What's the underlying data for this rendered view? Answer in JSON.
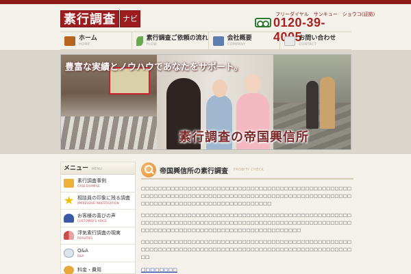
{
  "header": {
    "logo_text": "素行調査",
    "logo_sub": "ナビ",
    "phone_caption": "フリーダイヤル　サンキュー　ショウコ(証拠)",
    "phone_number": "0120-39-4005"
  },
  "nav": {
    "items": [
      {
        "label": "ホーム",
        "en": "HOME",
        "icon": "home-icon",
        "color": "#b5651d"
      },
      {
        "label": "素行調査ご依頼の流れ",
        "en": "FLOW",
        "icon": "leaf-icon",
        "color": "#6aa84f"
      },
      {
        "label": "会社概要",
        "en": "COMPANY",
        "icon": "book-icon",
        "color": "#5b7fb0"
      },
      {
        "label": "お問い合わせ",
        "en": "CONTACT",
        "icon": "mail-icon",
        "color": "#cfcfcf"
      }
    ]
  },
  "hero": {
    "tagline": "豊富な実績とノウハウであなたをサポート。",
    "title": "素行調査の帝国興信所"
  },
  "sidebar": {
    "title": "メニュー",
    "title_en": "MENU",
    "items": [
      {
        "label": "素行調査事例",
        "en": "CASE EXAMPLE",
        "icon": "folder-icon",
        "color": "#f0b13c"
      },
      {
        "label": "相談員の印象に残る調査",
        "en": "IMPRESSIVE INVESTIGATION",
        "icon": "star-icon",
        "color": "#f0c000"
      },
      {
        "label": "お客様の喜びの声",
        "en": "CUSTOMER'S VOICE",
        "icon": "person-icon",
        "color": "#3a5aa8"
      },
      {
        "label": "浮気素行調査の現実",
        "en": "REALITIES",
        "icon": "couple-icon",
        "color": "#d04a4a"
      },
      {
        "label": "Q&A",
        "en": "Q&A",
        "icon": "chat-icon",
        "color": "#9ab"
      },
      {
        "label": "料金・費用",
        "en": "",
        "icon": "coin-icon",
        "color": "#e7a93a"
      }
    ]
  },
  "main": {
    "title": "帝国興信所の素行調査",
    "title_en": "PROBITY CHECK",
    "paragraphs": [
      "□□□□□□□□□□□□□□□□□□□□□□□□□□□□□□□□□□□□□□□□□□□□□□□□□□□□□□□□□□□□□□□□□□□□□□□□□□□□□□□□□□□□□□□□□□□□□□□□□□□□□□□□□□□□□□□□□□□□□□□□□□□□□□□□□□□",
      "□□□□□□□□□□□□□□□□□□□□□□□□□□□□□□□□□□□□□□□□□□□□□□□□□□□□□□□□□□□□□□□□□□□□□□□□□□□□□□□□□□□□□□□□□□□□□□□□□□□□□□□□□□□□□□□□□□□□□□□□□□□□□□□□□□□□□□□□□□",
      "□□□□□□□□□□□□□□□□□□□□□□□□□□□□□□□□□□□□□□□□□□□□□□□□□□□□□□□□□□□□□□□□□□□□□□□□□□□□□□□□□□□□□□□□□□□□□□□□□□□□□□"
    ],
    "link_text": "□□□□□□□□"
  }
}
